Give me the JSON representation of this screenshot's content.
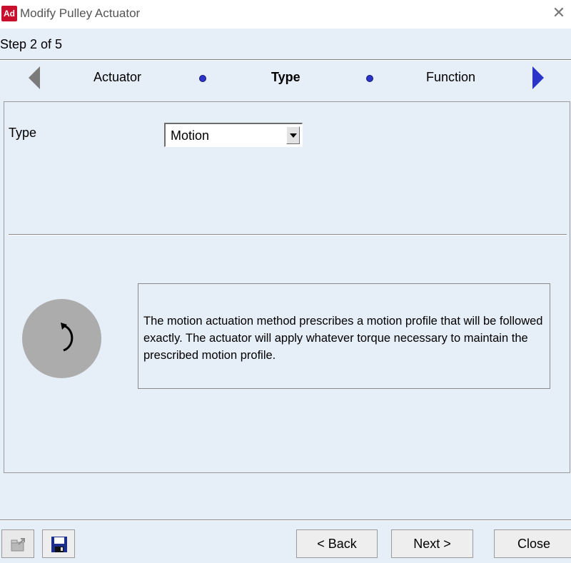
{
  "window": {
    "app_logo": "Ad",
    "title": "Modify Pulley Actuator",
    "close_glyph": "✕"
  },
  "wizard": {
    "step_label": "Step 2 of 5",
    "steps": [
      "Actuator",
      "Type",
      "Function"
    ],
    "current_step": "Type",
    "colors": {
      "active_arrow": "#2b34c8",
      "inactive_arrow": "#7a7a7a",
      "dot": "#2b34c8"
    }
  },
  "form": {
    "type_label": "Type",
    "type_value": "Motion"
  },
  "description": {
    "icon": "rotation-arrow-icon",
    "text": "The motion actuation method prescribes a motion profile that will be followed exactly. The actuator will apply whatever torque necessary to maintain the prescribed motion profile."
  },
  "footer": {
    "icons": [
      "export-icon",
      "save-icon"
    ],
    "back_label": "< Back",
    "next_label": "Next >",
    "close_label": "Close"
  }
}
